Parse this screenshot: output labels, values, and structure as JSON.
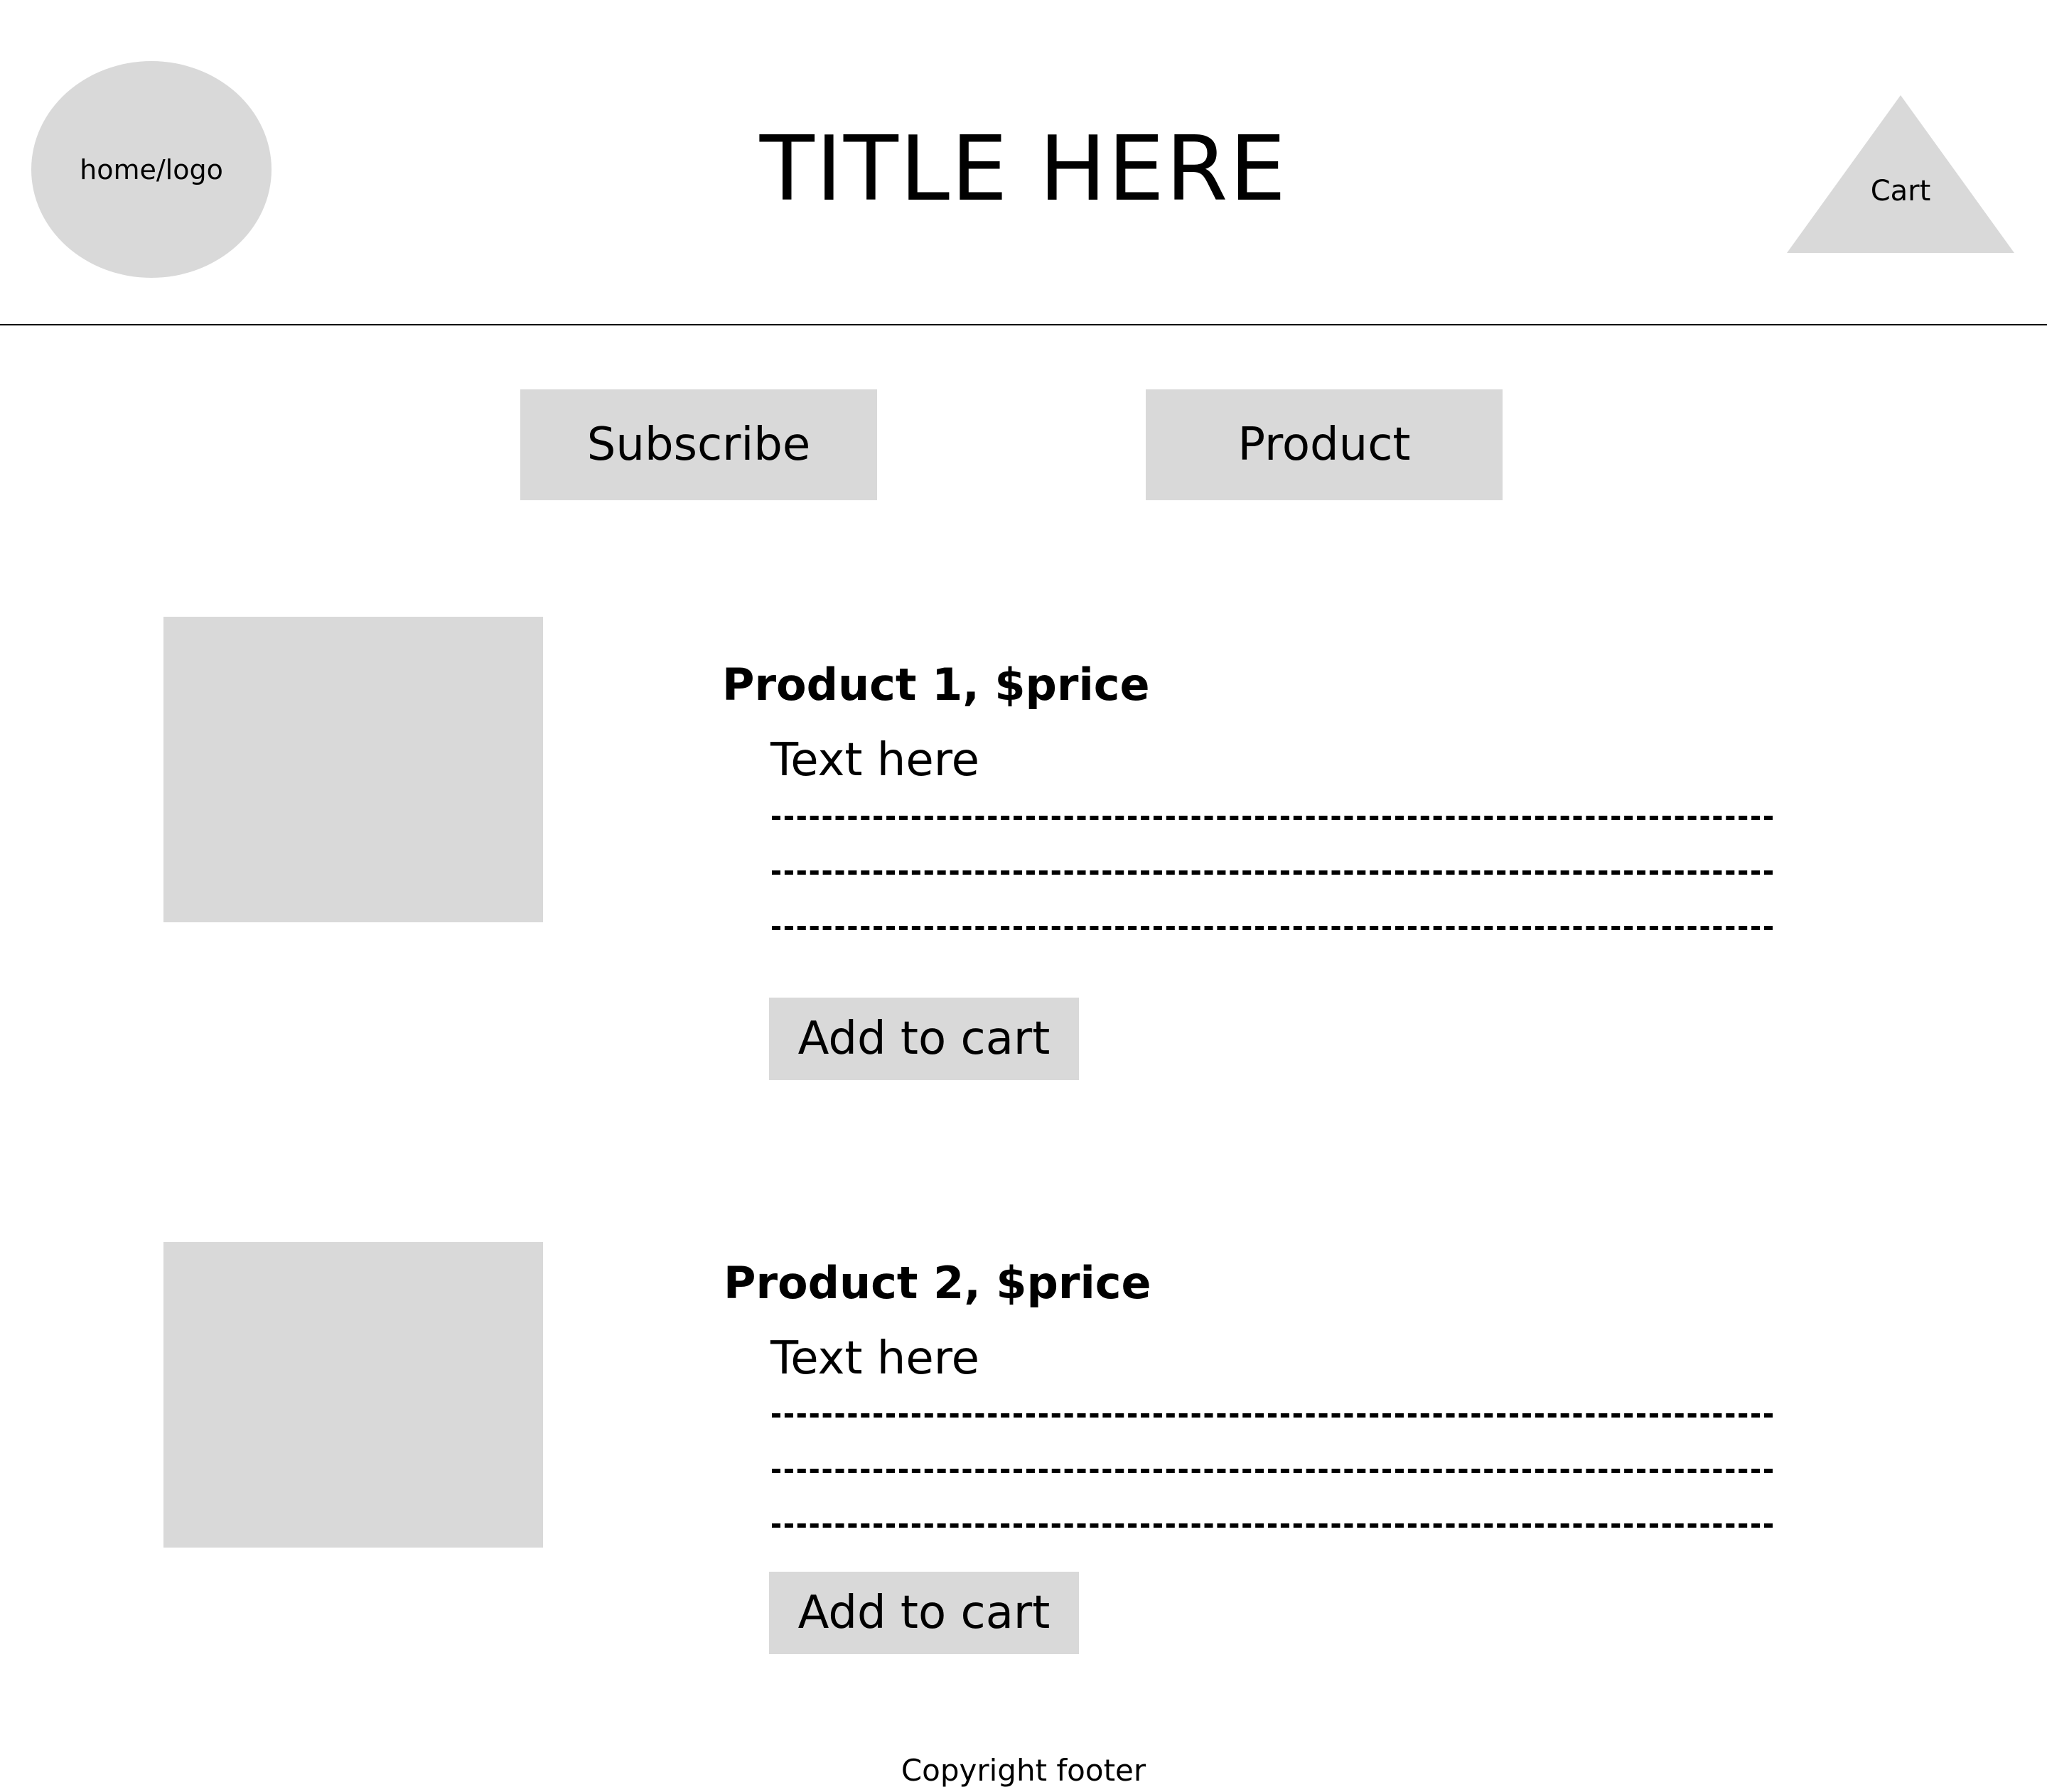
{
  "header": {
    "logo_label": "home/logo",
    "title": "TITLE HERE",
    "cart_label": "Cart"
  },
  "nav": {
    "subscribe_label": "Subscribe",
    "product_label": "Product"
  },
  "products": [
    {
      "name": "Product 1, $price",
      "text": "Text here",
      "button_label": "Add to cart"
    },
    {
      "name": "Product 2, $price",
      "text": "Text here",
      "button_label": "Add to cart"
    }
  ],
  "footer": {
    "copyright": "Copyright footer"
  },
  "colors": {
    "placeholder_gray": "#d9d9d9",
    "text": "#000000",
    "background": "#ffffff"
  }
}
